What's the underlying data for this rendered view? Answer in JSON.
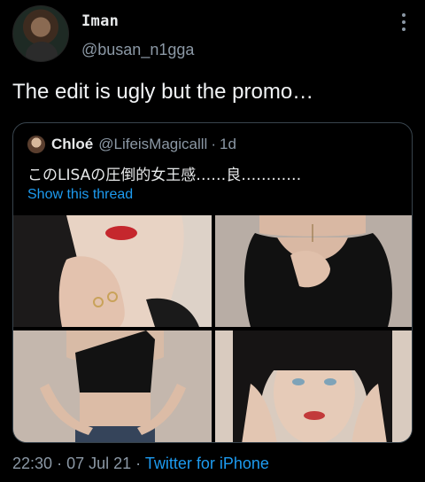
{
  "author": {
    "display_name": "Iman",
    "handle": "@busan_n1gga"
  },
  "tweet": {
    "text": "The edit is ugly but the promo…"
  },
  "quote": {
    "name": "Chloé",
    "handle": "@LifeisMagicalll",
    "separator": "·",
    "time": "1d",
    "text": "このLISAの圧倒的女王感……良…………",
    "show_thread": "Show this thread"
  },
  "meta": {
    "time": "22:30",
    "dot1": "·",
    "date": "07 Jul 21",
    "dot2": "·",
    "source": "Twitter for iPhone"
  },
  "colors": {
    "background": "#000000",
    "accent": "#1d9bf0",
    "secondary_text": "#8b98a5",
    "border": "#38444d"
  },
  "icons": {
    "more": "vertical-ellipsis-icon"
  }
}
